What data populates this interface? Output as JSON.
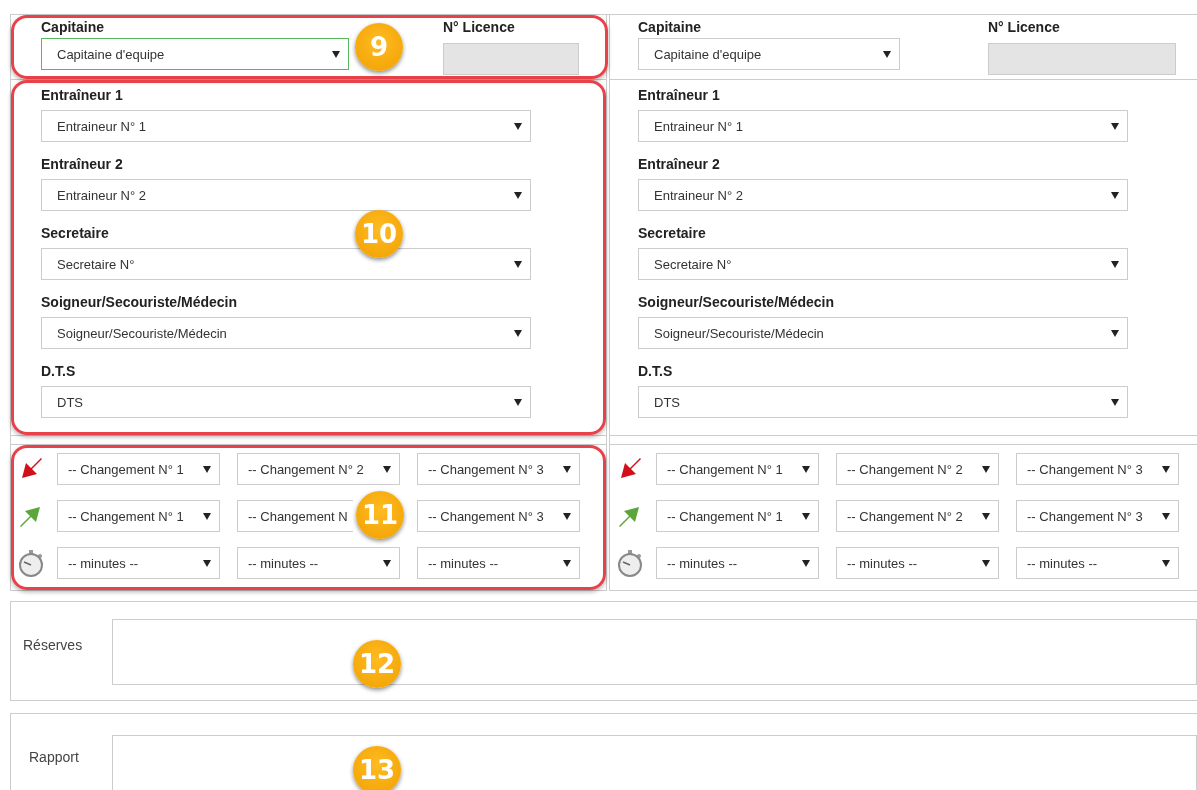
{
  "teams": [
    {
      "captain": {
        "label": "Capitaine",
        "value": "Capitaine d'equipe",
        "focused": true,
        "badge": "9"
      },
      "licence": {
        "label": "N° Licence",
        "disabled": true
      },
      "staff": {
        "badge": "10",
        "fields": [
          {
            "label": "Entraîneur 1",
            "value": "Entraineur N° 1"
          },
          {
            "label": "Entraîneur 2",
            "value": "Entraineur N° 2"
          },
          {
            "label": "Secretaire",
            "value": "Secretaire N°"
          },
          {
            "label": "Soigneur/Secouriste/Médecin",
            "value": "Soigneur/Secouriste/Médecin"
          },
          {
            "label": "D.T.S",
            "value": "DTS"
          }
        ]
      },
      "substitutions": {
        "badge": "11",
        "rows": [
          {
            "kind": "out",
            "selects": [
              {
                "value": "-- Changement N° 1",
                "caret": true
              },
              {
                "value": "-- Changement N° 2",
                "caret": true
              },
              {
                "value": "-- Changement N° 3",
                "caret": true
              }
            ]
          },
          {
            "kind": "in",
            "selects": [
              {
                "value": "-- Changement N° 1",
                "caret": true
              },
              {
                "value": "-- Changement N",
                "caret": false
              },
              {
                "value": "-- Changement N° 3",
                "caret": true
              }
            ]
          },
          {
            "kind": "time",
            "selects": [
              {
                "value": "-- minutes --",
                "caret": true
              },
              {
                "value": "-- minutes --",
                "caret": true
              },
              {
                "value": "-- minutes --",
                "caret": true
              }
            ]
          }
        ]
      }
    },
    {
      "captain": {
        "label": "Capitaine",
        "value": "Capitaine d'equipe",
        "focused": false
      },
      "licence": {
        "label": "N° Licence",
        "disabled": true
      },
      "staff": {
        "fields": [
          {
            "label": "Entraîneur 1",
            "value": "Entraineur N° 1"
          },
          {
            "label": "Entraîneur 2",
            "value": "Entraineur N° 2"
          },
          {
            "label": "Secretaire",
            "value": "Secretaire N°"
          },
          {
            "label": "Soigneur/Secouriste/Médecin",
            "value": "Soigneur/Secouriste/Médecin"
          },
          {
            "label": "D.T.S",
            "value": "DTS"
          }
        ]
      },
      "substitutions": {
        "rows": [
          {
            "kind": "out",
            "selects": [
              {
                "value": "-- Changement N° 1",
                "caret": true
              },
              {
                "value": "-- Changement N° 2",
                "caret": true
              },
              {
                "value": "-- Changement N° 3",
                "caret": true
              }
            ]
          },
          {
            "kind": "in",
            "selects": [
              {
                "value": "-- Changement N° 1",
                "caret": true
              },
              {
                "value": "-- Changement N° 2",
                "caret": true
              },
              {
                "value": "-- Changement N° 3",
                "caret": true
              }
            ]
          },
          {
            "kind": "time",
            "selects": [
              {
                "value": "-- minutes --",
                "caret": true
              },
              {
                "value": "-- minutes --",
                "caret": true
              },
              {
                "value": "-- minutes --",
                "caret": true
              }
            ]
          }
        ]
      }
    }
  ],
  "notes": [
    {
      "label": "Réserves",
      "badge": "12"
    },
    {
      "label": "Rapport",
      "badge": "13"
    }
  ]
}
